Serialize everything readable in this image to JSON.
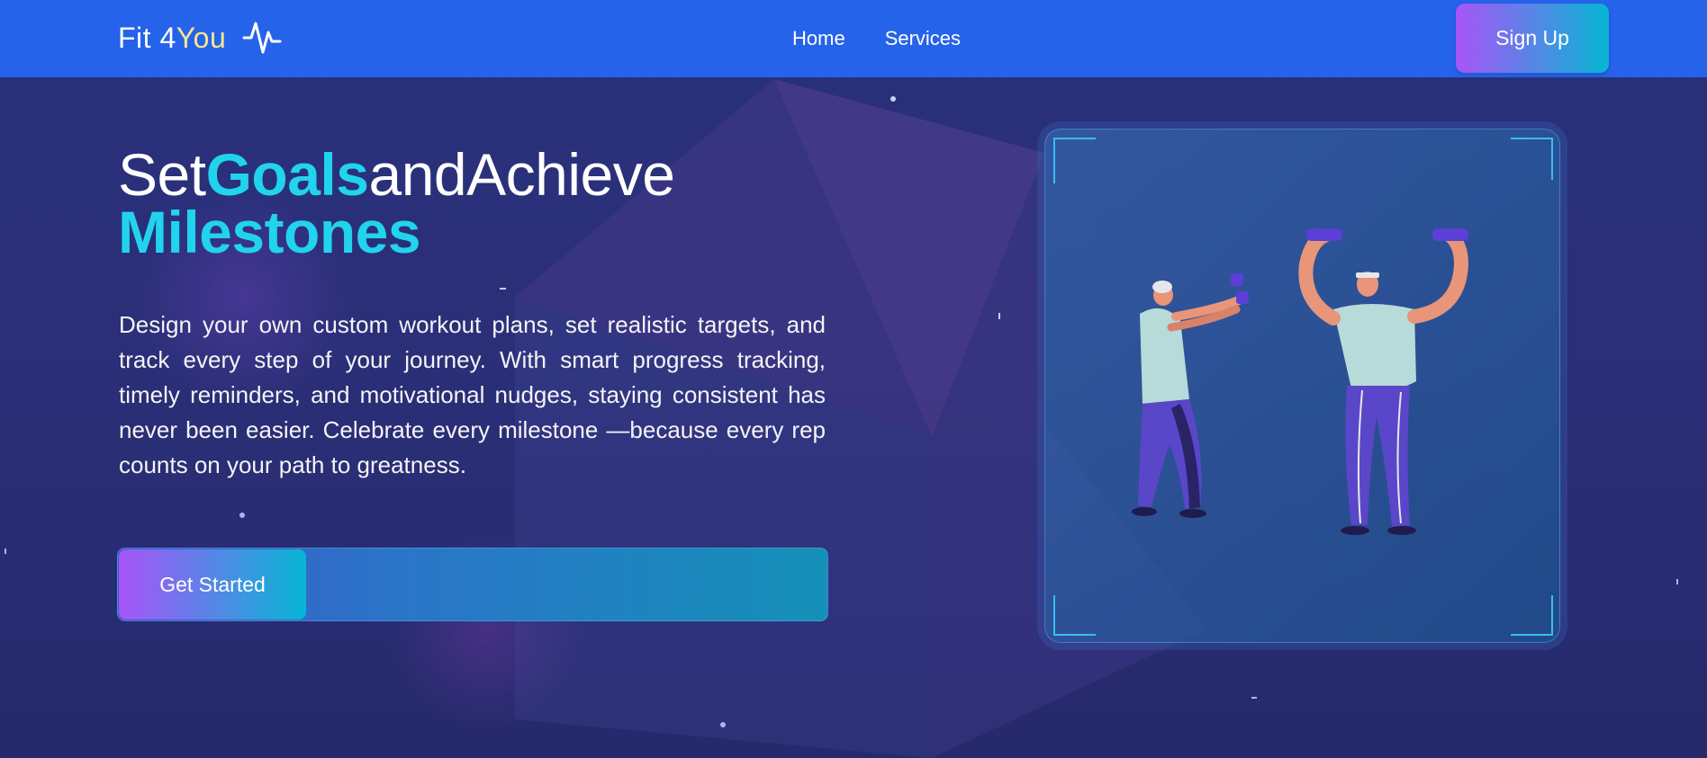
{
  "header": {
    "brand_main": "Fit 4",
    "brand_accent": "You",
    "nav": [
      {
        "label": "Home"
      },
      {
        "label": "Services"
      }
    ],
    "signup_label": "Sign Up"
  },
  "hero": {
    "headline_part1": "Set",
    "headline_part2": "Goals",
    "headline_part3": "and",
    "headline_part4": "Achieve",
    "headline_part5": "Milestones",
    "description": "Design your own custom workout plans, set realistic targets, and track every step of your journey. With smart progress tracking, timely reminders, and motivational nudges, staying consistent has never been easier. Celebrate every milestone —because every rep counts on your path to greatness.",
    "cta_label": "Get Started"
  },
  "illustration": {
    "subject": "two people lifting dumbbells"
  },
  "colors": {
    "header_bg": "#2563eb",
    "accent_cyan": "#22d3ee",
    "brand_accent": "#fde68a",
    "gradient_start": "#a855f7",
    "gradient_end": "#06b6d4",
    "page_bg": "#25296b"
  }
}
